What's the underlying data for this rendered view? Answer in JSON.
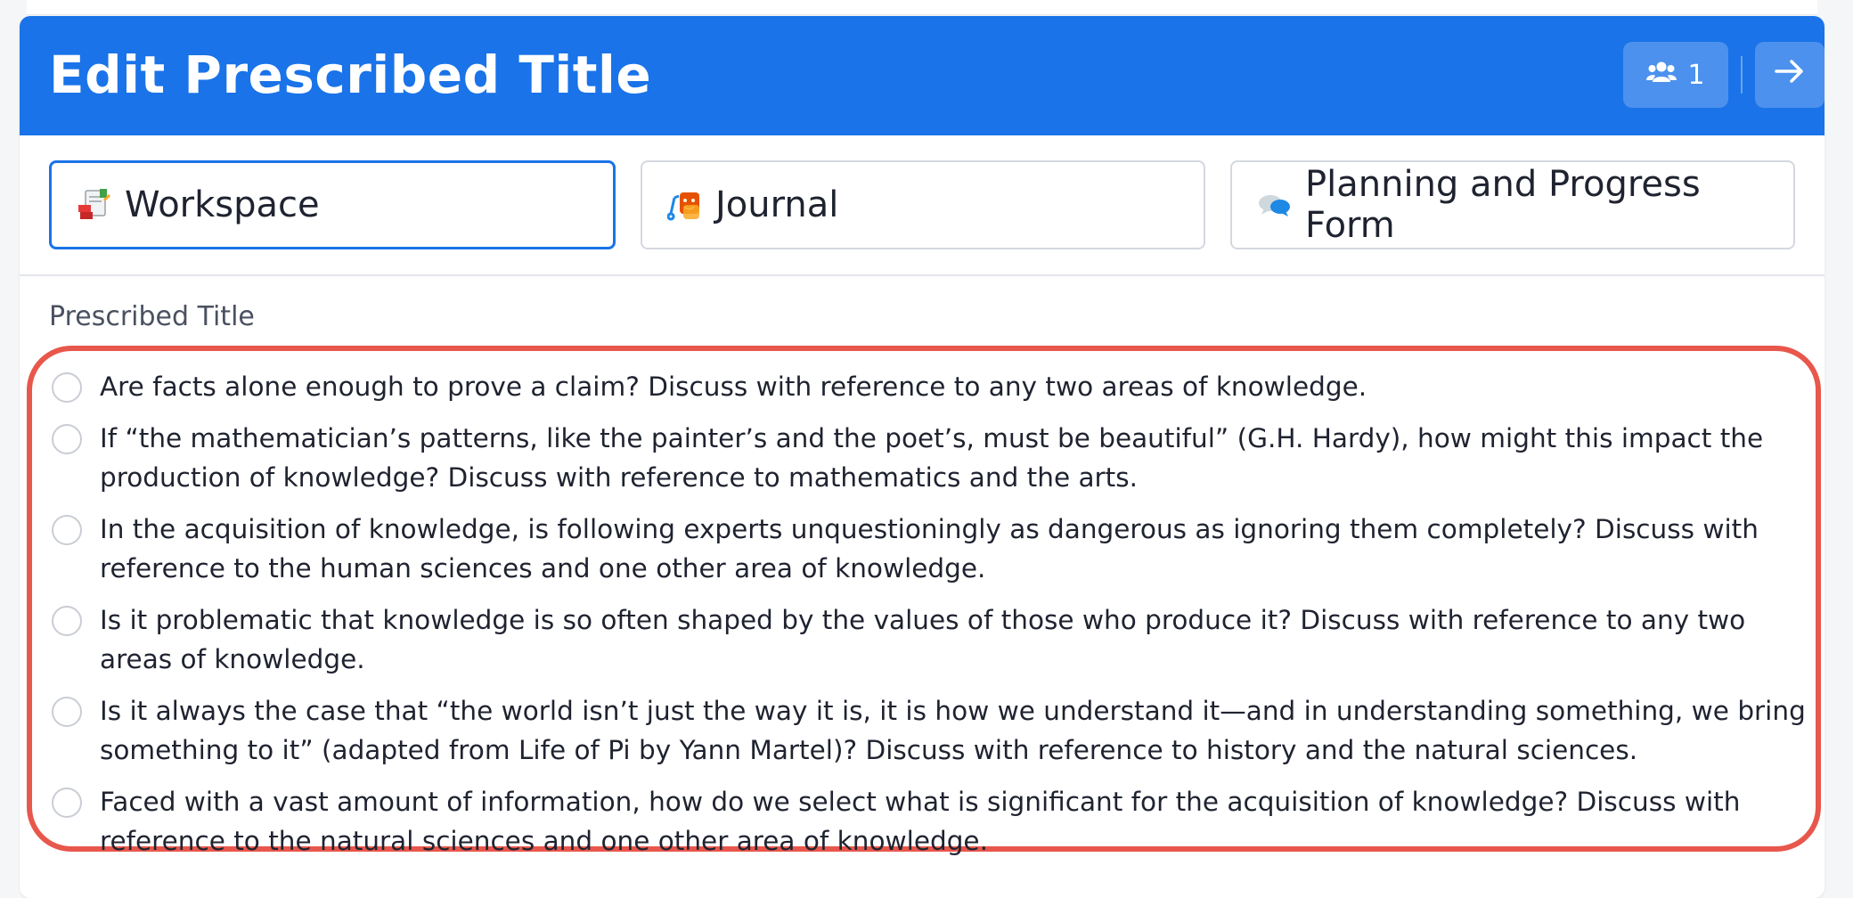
{
  "header": {
    "title": "Edit Prescribed Title",
    "participants_count": "1",
    "users_icon": "users-icon",
    "next_icon": "arrow-right-icon"
  },
  "tabs": [
    {
      "label": "Workspace",
      "icon": "workspace-notes-icon",
      "active": true
    },
    {
      "label": "Journal",
      "icon": "journal-theatre-icon",
      "active": false
    },
    {
      "label": "Planning and Progress Form",
      "icon": "speech-bubbles-icon",
      "active": false
    }
  ],
  "section_label": "Prescribed Title",
  "options": [
    "Are facts alone enough to prove a claim? Discuss with reference to any two areas of knowledge.",
    "If “the mathematician’s patterns, like the painter’s and the poet’s, must be beautiful” (G.H. Hardy), how might this impact the production of knowledge? Discuss with reference to mathematics and the arts.",
    "In the acquisition of knowledge, is following experts unquestioningly as dangerous as ignoring them completely? Discuss with reference to the human sciences and one other area of knowledge.",
    "Is it problematic that knowledge is so often shaped by the values of those who produce it? Discuss with reference to any two areas of knowledge.",
    "Is it always the case that “the world isn’t just the way it is, it is how we understand it—and in understanding something, we bring something to it” (adapted from Life of Pi by Yann Martel)? Discuss with reference to history and the natural sciences.",
    "Faced with a vast amount of information, how do we select what is significant for the acquisition of knowledge? Discuss with reference to the natural sciences and one other area of knowledge."
  ],
  "colors": {
    "header_bg": "#1a73e8",
    "highlight_border": "#e8574c",
    "active_tab_border": "#1a73e8"
  }
}
